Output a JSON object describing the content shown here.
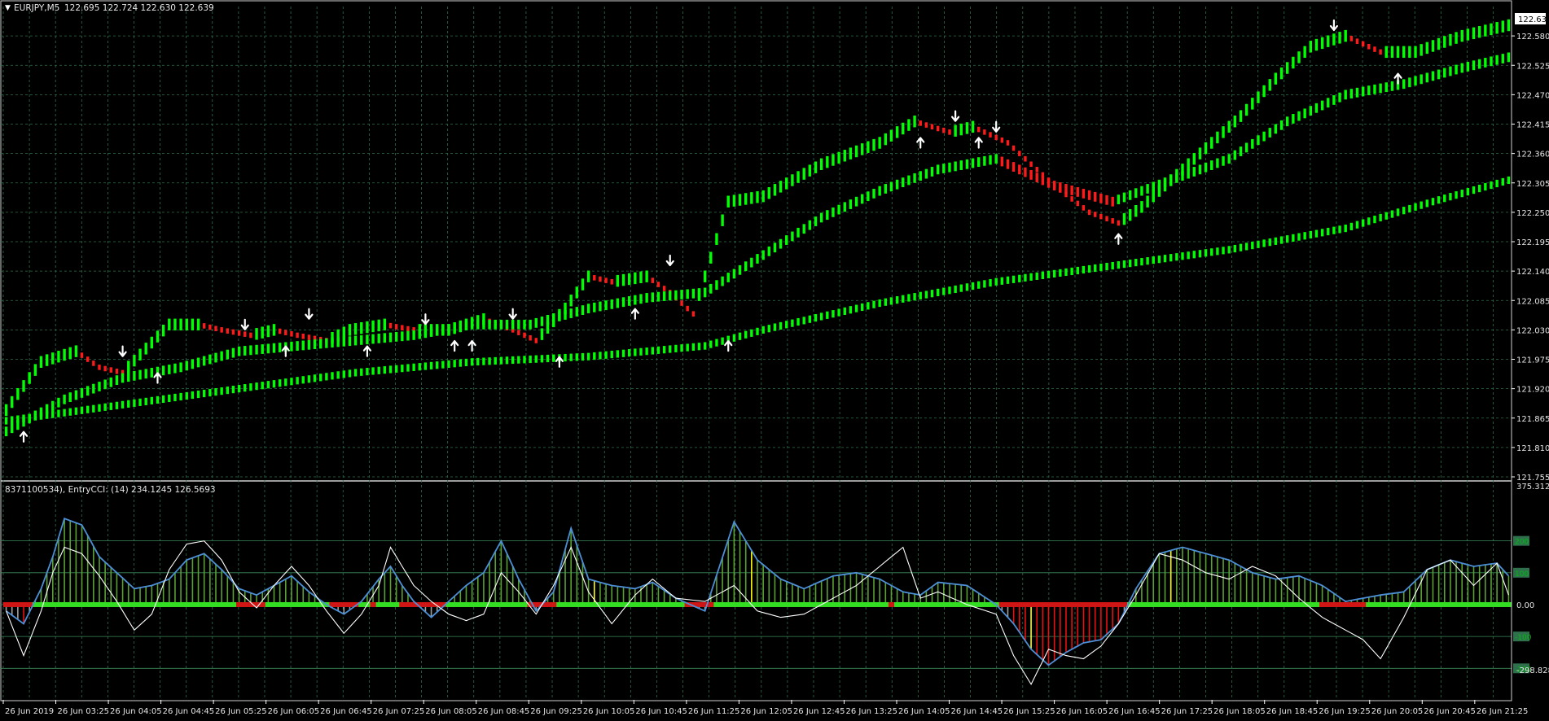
{
  "price_panel": {
    "symbol_label": "EURJPY,M5",
    "ohlc_text": "122.695 122.724 122.630 122.639",
    "current_price": "122.639",
    "y_ticks": [
      "122.580",
      "122.525",
      "122.470",
      "122.415",
      "122.360",
      "122.305",
      "122.250",
      "122.195",
      "122.140",
      "122.085",
      "122.030",
      "121.975",
      "121.920",
      "121.865",
      "121.810",
      "121.755"
    ]
  },
  "indicator_panel": {
    "title": "8371100534), EntryCCI: (14) 234.1245 126.5693",
    "scale_max": "375.3121",
    "scale_min": "-298.8287",
    "levels": [
      "200",
      "100",
      "0.00",
      "-100",
      "-200"
    ]
  },
  "time_axis": [
    "26 Jun 2019",
    "26 Jun 03:25",
    "26 Jun 04:05",
    "26 Jun 04:45",
    "26 Jun 05:25",
    "26 Jun 06:05",
    "26 Jun 06:45",
    "26 Jun 07:25",
    "26 Jun 08:05",
    "26 Jun 08:45",
    "26 Jun 09:25",
    "26 Jun 10:05",
    "26 Jun 10:45",
    "26 Jun 11:25",
    "26 Jun 12:05",
    "26 Jun 12:45",
    "26 Jun 13:25",
    "26 Jun 14:05",
    "26 Jun 14:45",
    "26 Jun 15:25",
    "26 Jun 16:05",
    "26 Jun 16:45",
    "26 Jun 17:25",
    "26 Jun 18:05",
    "26 Jun 18:45",
    "26 Jun 19:25",
    "26 Jun 20:05",
    "26 Jun 20:45",
    "26 Jun 21:25"
  ],
  "colors": {
    "bull": "#00ff00",
    "bear": "#ff1a1a",
    "grid": "#2f6f4c",
    "axis": "#ffffff",
    "cci_fast": "#ffffff",
    "cci_slow": "#4d8fd6",
    "hist_green": "#5aa032",
    "hist_red": "#e81010",
    "hist_gray": "#a0a0a0",
    "hist_yellow": "#ffff00"
  },
  "chart_data": [
    {
      "type": "candlestick",
      "series": [
        {
          "name": "fast",
          "points": [
            [
              0,
              121.88
            ],
            [
              6,
              121.97
            ],
            [
              12,
              121.99
            ],
            [
              16,
              121.96
            ],
            [
              20,
              121.95
            ],
            [
              28,
              122.04
            ],
            [
              33,
              122.04
            ],
            [
              37,
              122.03
            ],
            [
              42,
              122.02
            ],
            [
              46,
              122.03
            ],
            [
              50,
              122.02
            ],
            [
              55,
              122.01
            ],
            [
              59,
              122.03
            ],
            [
              65,
              122.04
            ],
            [
              70,
              122.03
            ],
            [
              76,
              122.03
            ],
            [
              82,
              122.05
            ],
            [
              87,
              122.03
            ],
            [
              91,
              122.01
            ],
            [
              96,
              122.07
            ],
            [
              100,
              122.13
            ],
            [
              104,
              122.12
            ],
            [
              110,
              122.13
            ],
            [
              114,
              122.1
            ],
            [
              118,
              122.06
            ],
            [
              124,
              122.27
            ],
            [
              130,
              122.28
            ],
            [
              140,
              122.34
            ],
            [
              150,
              122.38
            ],
            [
              156,
              122.42
            ],
            [
              162,
              122.4
            ],
            [
              166,
              122.41
            ],
            [
              172,
              122.38
            ],
            [
              180,
              122.3
            ],
            [
              186,
              122.25
            ],
            [
              191,
              122.23
            ],
            [
              195,
              122.26
            ],
            [
              205,
              122.36
            ],
            [
              212,
              122.43
            ],
            [
              218,
              122.5
            ],
            [
              224,
              122.56
            ],
            [
              230,
              122.58
            ],
            [
              236,
              122.55
            ],
            [
              242,
              122.55
            ],
            [
              250,
              122.58
            ],
            [
              258,
              122.6
            ]
          ]
        },
        {
          "name": "mid",
          "points": [
            [
              0,
              121.84
            ],
            [
              10,
              121.9
            ],
            [
              20,
              121.94
            ],
            [
              30,
              121.96
            ],
            [
              40,
              121.99
            ],
            [
              50,
              122.0
            ],
            [
              60,
              122.01
            ],
            [
              70,
              122.02
            ],
            [
              80,
              122.04
            ],
            [
              90,
              122.04
            ],
            [
              100,
              122.07
            ],
            [
              110,
              122.09
            ],
            [
              120,
              122.1
            ],
            [
              130,
              122.17
            ],
            [
              140,
              122.24
            ],
            [
              150,
              122.29
            ],
            [
              160,
              122.33
            ],
            [
              170,
              122.35
            ],
            [
              180,
              122.3
            ],
            [
              190,
              122.27
            ],
            [
              200,
              122.31
            ],
            [
              210,
              122.35
            ],
            [
              220,
              122.42
            ],
            [
              230,
              122.47
            ],
            [
              240,
              122.49
            ],
            [
              250,
              122.52
            ],
            [
              258,
              122.54
            ]
          ]
        },
        {
          "name": "slow",
          "points": [
            [
              0,
              121.86
            ],
            [
              20,
              121.89
            ],
            [
              40,
              121.92
            ],
            [
              60,
              121.95
            ],
            [
              80,
              121.97
            ],
            [
              100,
              121.98
            ],
            [
              120,
              122.0
            ],
            [
              130,
              122.03
            ],
            [
              150,
              122.08
            ],
            [
              170,
              122.12
            ],
            [
              190,
              122.15
            ],
            [
              210,
              122.18
            ],
            [
              230,
              122.22
            ],
            [
              245,
              122.27
            ],
            [
              258,
              122.31
            ]
          ]
        }
      ],
      "arrows_up": [
        [
          3,
          121.83
        ],
        [
          26,
          121.94
        ],
        [
          48,
          121.99
        ],
        [
          62,
          121.99
        ],
        [
          77,
          122.0
        ],
        [
          80,
          122.0
        ],
        [
          95,
          121.97
        ],
        [
          108,
          122.06
        ],
        [
          124,
          122.0
        ],
        [
          157,
          122.38
        ],
        [
          167,
          122.38
        ],
        [
          191,
          122.2
        ],
        [
          239,
          122.5
        ]
      ],
      "arrows_down": [
        [
          20,
          121.99
        ],
        [
          41,
          122.04
        ],
        [
          52,
          122.06
        ],
        [
          72,
          122.05
        ],
        [
          87,
          122.06
        ],
        [
          114,
          122.16
        ],
        [
          163,
          122.43
        ],
        [
          170,
          122.41
        ],
        [
          228,
          122.6
        ]
      ],
      "ylim": [
        121.755,
        122.635
      ]
    },
    {
      "type": "line",
      "series": [
        {
          "name": "fast",
          "points": [
            [
              0,
              -20
            ],
            [
              3,
              -160
            ],
            [
              6,
              -20
            ],
            [
              8,
              100
            ],
            [
              10,
              180
            ],
            [
              13,
              160
            ],
            [
              16,
              90
            ],
            [
              19,
              10
            ],
            [
              22,
              -80
            ],
            [
              25,
              -30
            ],
            [
              28,
              110
            ],
            [
              31,
              190
            ],
            [
              34,
              200
            ],
            [
              37,
              140
            ],
            [
              40,
              40
            ],
            [
              43,
              -10
            ],
            [
              46,
              60
            ],
            [
              49,
              120
            ],
            [
              52,
              60
            ],
            [
              55,
              -20
            ],
            [
              58,
              -90
            ],
            [
              61,
              -30
            ],
            [
              64,
              60
            ],
            [
              66,
              180
            ],
            [
              68,
              120
            ],
            [
              70,
              60
            ],
            [
              73,
              10
            ],
            [
              76,
              -30
            ],
            [
              79,
              -50
            ],
            [
              82,
              -30
            ],
            [
              85,
              100
            ],
            [
              88,
              40
            ],
            [
              91,
              -30
            ],
            [
              94,
              60
            ],
            [
              97,
              180
            ],
            [
              100,
              40
            ],
            [
              104,
              -60
            ],
            [
              108,
              30
            ],
            [
              111,
              80
            ],
            [
              115,
              20
            ],
            [
              120,
              10
            ],
            [
              125,
              60
            ],
            [
              129,
              -20
            ],
            [
              133,
              -40
            ],
            [
              137,
              -30
            ],
            [
              142,
              20
            ],
            [
              146,
              60
            ],
            [
              150,
              120
            ],
            [
              154,
              180
            ],
            [
              157,
              20
            ],
            [
              160,
              40
            ],
            [
              165,
              0
            ],
            [
              170,
              -30
            ],
            [
              173,
              -160
            ],
            [
              176,
              -250
            ],
            [
              179,
              -140
            ],
            [
              182,
              -160
            ],
            [
              185,
              -170
            ],
            [
              188,
              -130
            ],
            [
              191,
              -60
            ],
            [
              194,
              30
            ],
            [
              198,
              160
            ],
            [
              202,
              140
            ],
            [
              206,
              100
            ],
            [
              210,
              80
            ],
            [
              214,
              120
            ],
            [
              218,
              90
            ],
            [
              222,
              20
            ],
            [
              226,
              -40
            ],
            [
              230,
              -80
            ],
            [
              233,
              -110
            ],
            [
              236,
              -170
            ],
            [
              240,
              -40
            ],
            [
              244,
              110
            ],
            [
              248,
              140
            ],
            [
              252,
              60
            ],
            [
              256,
              130
            ],
            [
              258,
              30
            ]
          ]
        },
        {
          "name": "slow",
          "points": [
            [
              0,
              -20
            ],
            [
              3,
              -60
            ],
            [
              6,
              50
            ],
            [
              8,
              150
            ],
            [
              10,
              270
            ],
            [
              13,
              250
            ],
            [
              16,
              150
            ],
            [
              19,
              100
            ],
            [
              22,
              50
            ],
            [
              25,
              60
            ],
            [
              28,
              80
            ],
            [
              31,
              140
            ],
            [
              34,
              160
            ],
            [
              37,
              110
            ],
            [
              40,
              50
            ],
            [
              43,
              30
            ],
            [
              46,
              60
            ],
            [
              49,
              90
            ],
            [
              52,
              40
            ],
            [
              55,
              0
            ],
            [
              58,
              -30
            ],
            [
              61,
              10
            ],
            [
              64,
              80
            ],
            [
              66,
              120
            ],
            [
              68,
              60
            ],
            [
              70,
              10
            ],
            [
              73,
              -40
            ],
            [
              76,
              10
            ],
            [
              79,
              60
            ],
            [
              82,
              100
            ],
            [
              85,
              200
            ],
            [
              88,
              80
            ],
            [
              91,
              -20
            ],
            [
              94,
              40
            ],
            [
              97,
              240
            ],
            [
              100,
              80
            ],
            [
              104,
              60
            ],
            [
              108,
              50
            ],
            [
              111,
              70
            ],
            [
              115,
              20
            ],
            [
              120,
              -20
            ],
            [
              125,
              260
            ],
            [
              129,
              140
            ],
            [
              133,
              80
            ],
            [
              137,
              50
            ],
            [
              142,
              90
            ],
            [
              146,
              100
            ],
            [
              150,
              80
            ],
            [
              154,
              40
            ],
            [
              157,
              30
            ],
            [
              160,
              70
            ],
            [
              165,
              60
            ],
            [
              170,
              0
            ],
            [
              173,
              -60
            ],
            [
              176,
              -140
            ],
            [
              179,
              -190
            ],
            [
              182,
              -150
            ],
            [
              185,
              -120
            ],
            [
              188,
              -110
            ],
            [
              191,
              -60
            ],
            [
              194,
              50
            ],
            [
              198,
              160
            ],
            [
              202,
              180
            ],
            [
              206,
              160
            ],
            [
              210,
              140
            ],
            [
              214,
              100
            ],
            [
              218,
              80
            ],
            [
              222,
              90
            ],
            [
              226,
              60
            ],
            [
              230,
              10
            ],
            [
              233,
              20
            ],
            [
              236,
              30
            ],
            [
              240,
              40
            ],
            [
              244,
              110
            ],
            [
              248,
              140
            ],
            [
              252,
              120
            ],
            [
              256,
              130
            ],
            [
              258,
              90
            ]
          ]
        }
      ],
      "levels": [
        200,
        100,
        0,
        -100,
        -200
      ],
      "ylim": [
        -298.8287,
        375.3121
      ]
    }
  ]
}
